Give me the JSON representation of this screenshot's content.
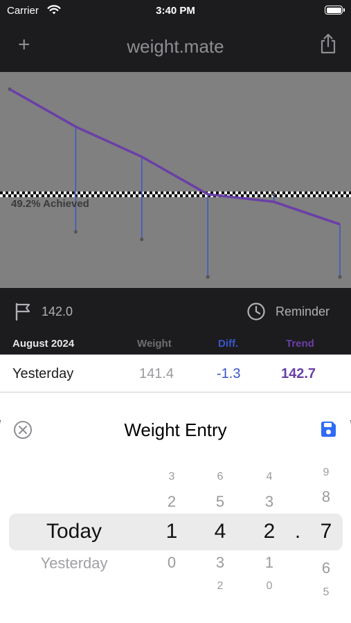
{
  "status_bar": {
    "carrier": "Carrier",
    "time": "3:40 PM"
  },
  "navbar": {
    "title": "weight.mate",
    "add_icon": "plus-icon",
    "share_icon": "share-icon"
  },
  "chart_data": {
    "type": "line",
    "annotation": "49.2% Achieved",
    "goal_line_style": "checkered",
    "series": [
      {
        "values": [
          143.4,
          142.9,
          142.5,
          142.0,
          141.9,
          141.6
        ],
        "color": "#6a3fa8"
      }
    ],
    "entry_values": [
      143.4,
      141.5,
      141.4,
      140.9,
      142.0,
      140.9
    ],
    "drop_line_color": "#3a56c8",
    "ylim": [
      140.9,
      143.5
    ],
    "goal": 142.0,
    "background": "#808080"
  },
  "goal_bar": {
    "goal_value": "142.0",
    "reminder_label": "Reminder",
    "flag_icon": "flag-icon",
    "clock_icon": "clock-icon"
  },
  "table": {
    "headers": {
      "month": "August 2024",
      "weight": "Weight",
      "diff": "Diff.",
      "trend": "Trend"
    },
    "rows": [
      {
        "day": "Yesterday",
        "weight": "141.4",
        "diff": "-1.3",
        "trend": "142.7"
      }
    ],
    "colors": {
      "diff": "#3a56c8",
      "trend": "#6a3fa8"
    }
  },
  "sheet": {
    "title": "Weight Entry",
    "close_icon": "close-circle-icon",
    "save_icon": "save-icon",
    "accent": "#2f6bf5",
    "picker": {
      "day": {
        "selected": "Today",
        "below": "Yesterday"
      },
      "hundreds": {
        "above2": "3",
        "above1": "2",
        "selected": "1",
        "below1": "0"
      },
      "tens": {
        "above2": "6",
        "above1": "5",
        "selected": "4",
        "below1": "3",
        "below2": "2"
      },
      "ones": {
        "above2": "4",
        "above1": "3",
        "selected": "2",
        "below1": "1",
        "below2": "0"
      },
      "separator": ".",
      "tenths": {
        "above2": "9",
        "above1": "8",
        "selected": "7",
        "below1": "6",
        "below2": "5"
      }
    }
  }
}
